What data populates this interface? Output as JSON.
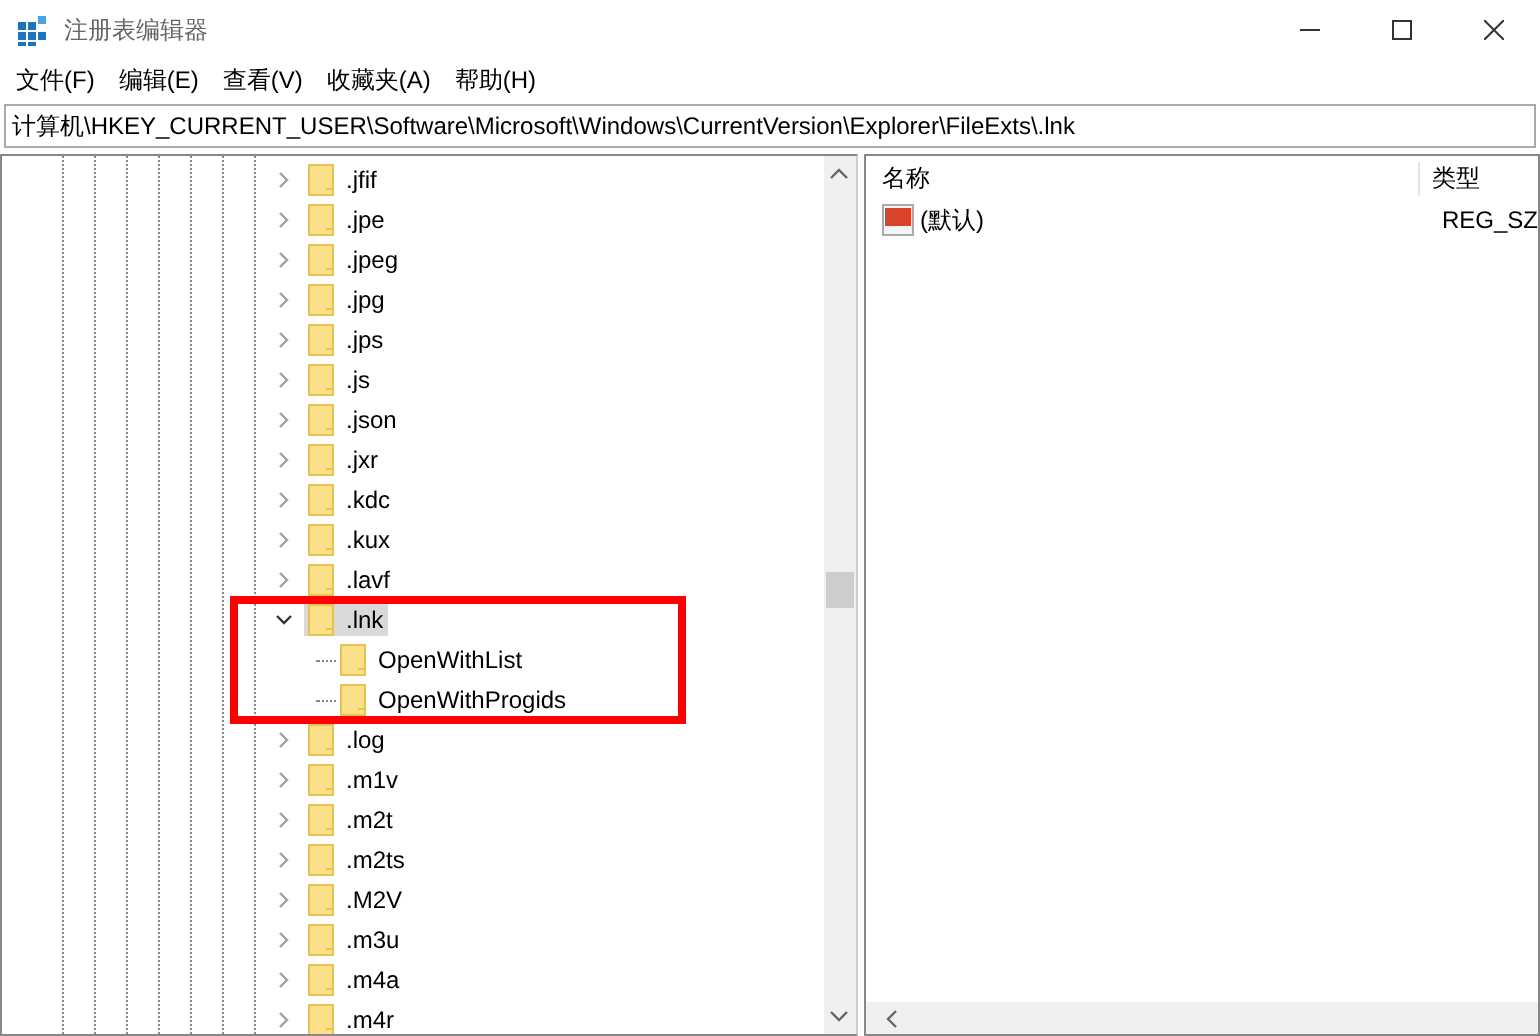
{
  "window": {
    "title": "注册表编辑器"
  },
  "menu": [
    "文件(F)",
    "编辑(E)",
    "查看(V)",
    "收藏夹(A)",
    "帮助(H)"
  ],
  "address": "计算机\\HKEY_CURRENT_USER\\Software\\Microsoft\\Windows\\CurrentVersion\\Explorer\\FileExts\\.lnk",
  "tree": [
    {
      "label": ".jfif",
      "expanded": false,
      "selected": false,
      "highlighted": false
    },
    {
      "label": ".jpe",
      "expanded": false,
      "selected": false,
      "highlighted": false
    },
    {
      "label": ".jpeg",
      "expanded": false,
      "selected": false,
      "highlighted": false
    },
    {
      "label": ".jpg",
      "expanded": false,
      "selected": false,
      "highlighted": false
    },
    {
      "label": ".jps",
      "expanded": false,
      "selected": false,
      "highlighted": false
    },
    {
      "label": ".js",
      "expanded": false,
      "selected": false,
      "highlighted": false
    },
    {
      "label": ".json",
      "expanded": false,
      "selected": false,
      "highlighted": false
    },
    {
      "label": ".jxr",
      "expanded": false,
      "selected": false,
      "highlighted": false
    },
    {
      "label": ".kdc",
      "expanded": false,
      "selected": false,
      "highlighted": false
    },
    {
      "label": ".kux",
      "expanded": false,
      "selected": false,
      "highlighted": false
    },
    {
      "label": ".lavf",
      "expanded": false,
      "selected": false,
      "highlighted": false
    },
    {
      "label": ".lnk",
      "expanded": true,
      "selected": true,
      "highlighted": true,
      "children": [
        {
          "label": "OpenWithList",
          "selected": false
        },
        {
          "label": "OpenWithProgids",
          "selected": false
        }
      ]
    },
    {
      "label": ".log",
      "expanded": false,
      "selected": false,
      "highlighted": false
    },
    {
      "label": ".m1v",
      "expanded": false,
      "selected": false,
      "highlighted": false
    },
    {
      "label": ".m2t",
      "expanded": false,
      "selected": false,
      "highlighted": false
    },
    {
      "label": ".m2ts",
      "expanded": false,
      "selected": false,
      "highlighted": false
    },
    {
      "label": ".M2V",
      "expanded": false,
      "selected": false,
      "highlighted": false
    },
    {
      "label": ".m3u",
      "expanded": false,
      "selected": false,
      "highlighted": false
    },
    {
      "label": ".m4a",
      "expanded": false,
      "selected": false,
      "highlighted": false
    },
    {
      "label": ".m4r",
      "expanded": false,
      "selected": false,
      "highlighted": false
    }
  ],
  "values": {
    "columns": [
      "名称",
      "类型"
    ],
    "rows": [
      {
        "name": "(默认)",
        "type": "REG_SZ"
      }
    ]
  }
}
